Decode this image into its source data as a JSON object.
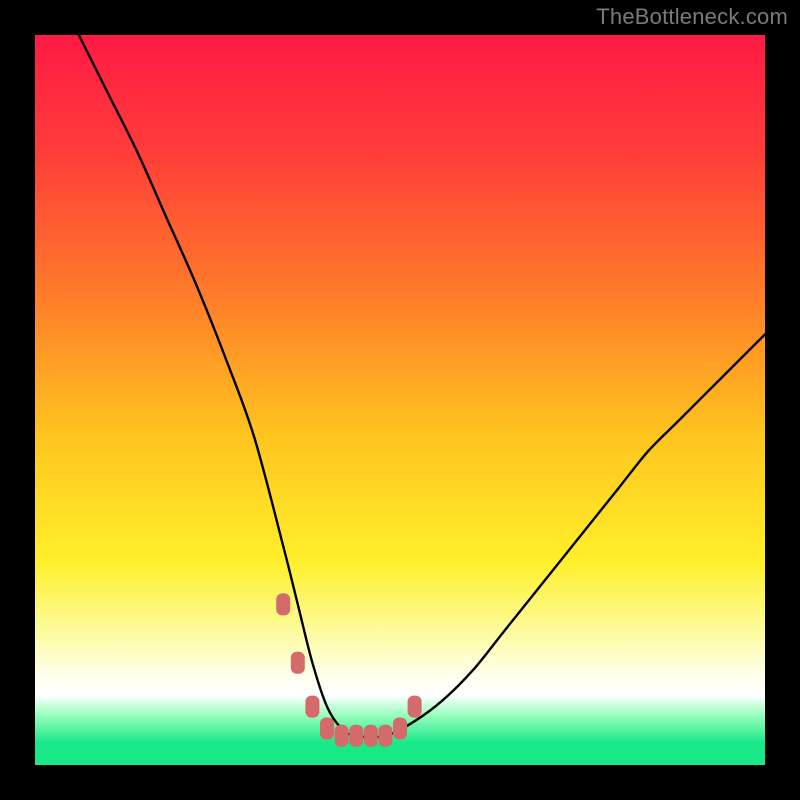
{
  "watermark": "TheBottleneck.com",
  "colors": {
    "frame": "#000000",
    "curve": "#000000",
    "marker": "#d46a6a",
    "gradient_stops": [
      {
        "offset": 0.0,
        "color": "#ff1a44"
      },
      {
        "offset": 0.15,
        "color": "#ff3a3a"
      },
      {
        "offset": 0.35,
        "color": "#ff7a2a"
      },
      {
        "offset": 0.55,
        "color": "#ffc51f"
      },
      {
        "offset": 0.72,
        "color": "#ffef2a"
      },
      {
        "offset": 0.82,
        "color": "#fdfca0"
      },
      {
        "offset": 0.88,
        "color": "#fffff0"
      },
      {
        "offset": 0.905,
        "color": "#ffffff"
      },
      {
        "offset": 0.93,
        "color": "#9effc0"
      },
      {
        "offset": 0.97,
        "color": "#18e887"
      },
      {
        "offset": 1.0,
        "color": "#18e887"
      }
    ]
  },
  "chart_data": {
    "type": "line",
    "title": "",
    "xlabel": "",
    "ylabel": "",
    "xlim": [
      0,
      100
    ],
    "ylim": [
      0,
      100
    ],
    "grid": false,
    "legend": false,
    "series": [
      {
        "name": "bottleneck-curve",
        "x": [
          6,
          10,
          14,
          18,
          22,
          26,
          30,
          34,
          36,
          38,
          40,
          42,
          44,
          48,
          52,
          56,
          60,
          64,
          68,
          72,
          76,
          80,
          84,
          88,
          92,
          96,
          100
        ],
        "y": [
          100,
          92,
          84,
          75,
          66,
          56,
          45,
          30,
          22,
          14,
          8,
          5,
          4,
          4,
          6,
          9,
          13,
          18,
          23,
          28,
          33,
          38,
          43,
          47,
          51,
          55,
          59
        ]
      }
    ],
    "annotations": {
      "markers": {
        "name": "low-bottleneck-region",
        "x": [
          34,
          36,
          38,
          40,
          42,
          44,
          46,
          48,
          50,
          52
        ],
        "y": [
          22,
          14,
          8,
          5,
          4,
          4,
          4,
          4,
          5,
          8
        ]
      }
    }
  }
}
